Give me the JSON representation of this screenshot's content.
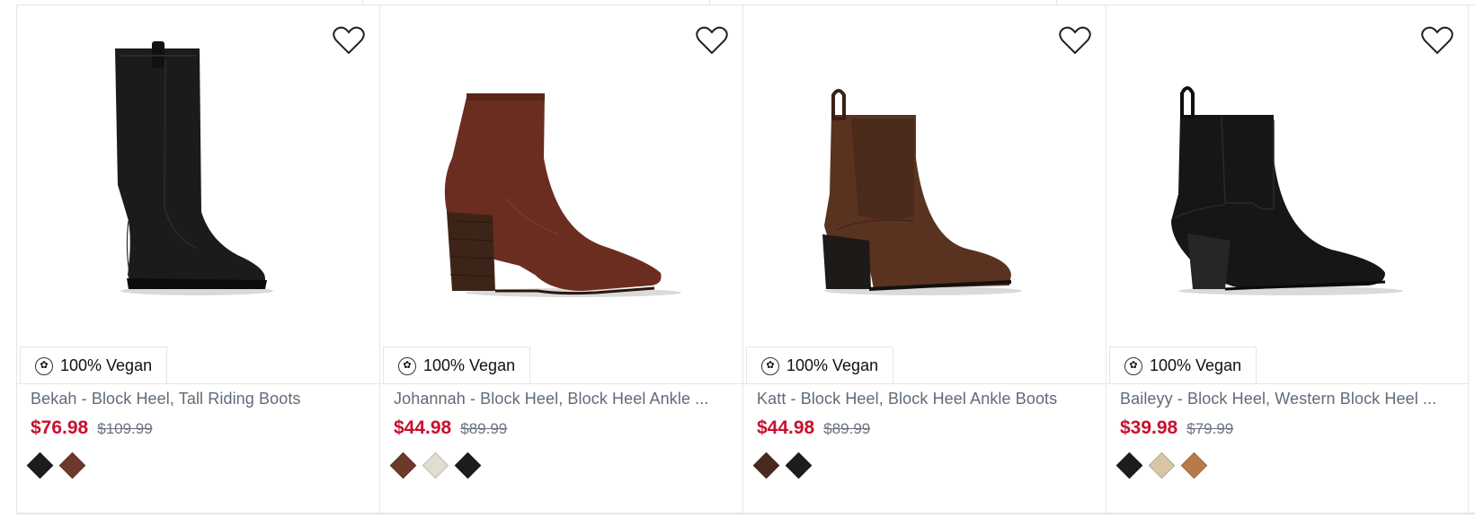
{
  "products": [
    {
      "badge": "100% Vegan",
      "name": "Bekah - Block Heel, Tall Riding Boots",
      "sale_price": "$76.98",
      "original_price": "$109.99",
      "swatches": [
        "#1c1c1c",
        "#6b3a2a"
      ],
      "image_icon": "tall-black-riding-boot"
    },
    {
      "badge": "100% Vegan",
      "name": "Johannah - Block Heel, Block Heel Ankle ...",
      "sale_price": "$44.98",
      "original_price": "$89.99",
      "swatches": [
        "#6b3a2a",
        "#e2ddd3",
        "#1c1c1c"
      ],
      "image_icon": "brown-suede-ankle-boot"
    },
    {
      "badge": "100% Vegan",
      "name": "Katt - Block Heel, Block Heel Ankle Boots",
      "sale_price": "$44.98",
      "original_price": "$89.99",
      "swatches": [
        "#4a2a1e",
        "#1c1c1c"
      ],
      "image_icon": "brown-leather-ankle-boot"
    },
    {
      "badge": "100% Vegan",
      "name": "Baileyy - Block Heel, Western Block Heel ...",
      "sale_price": "$39.98",
      "original_price": "$79.99",
      "swatches": [
        "#1c1c1c",
        "#d8c6a8",
        "#b87a4b"
      ],
      "image_icon": "black-western-ankle-boot"
    }
  ],
  "colors": {
    "sale_price": "#c8102e",
    "name_text": "#5f6b7a",
    "border": "#e6e6e6"
  }
}
